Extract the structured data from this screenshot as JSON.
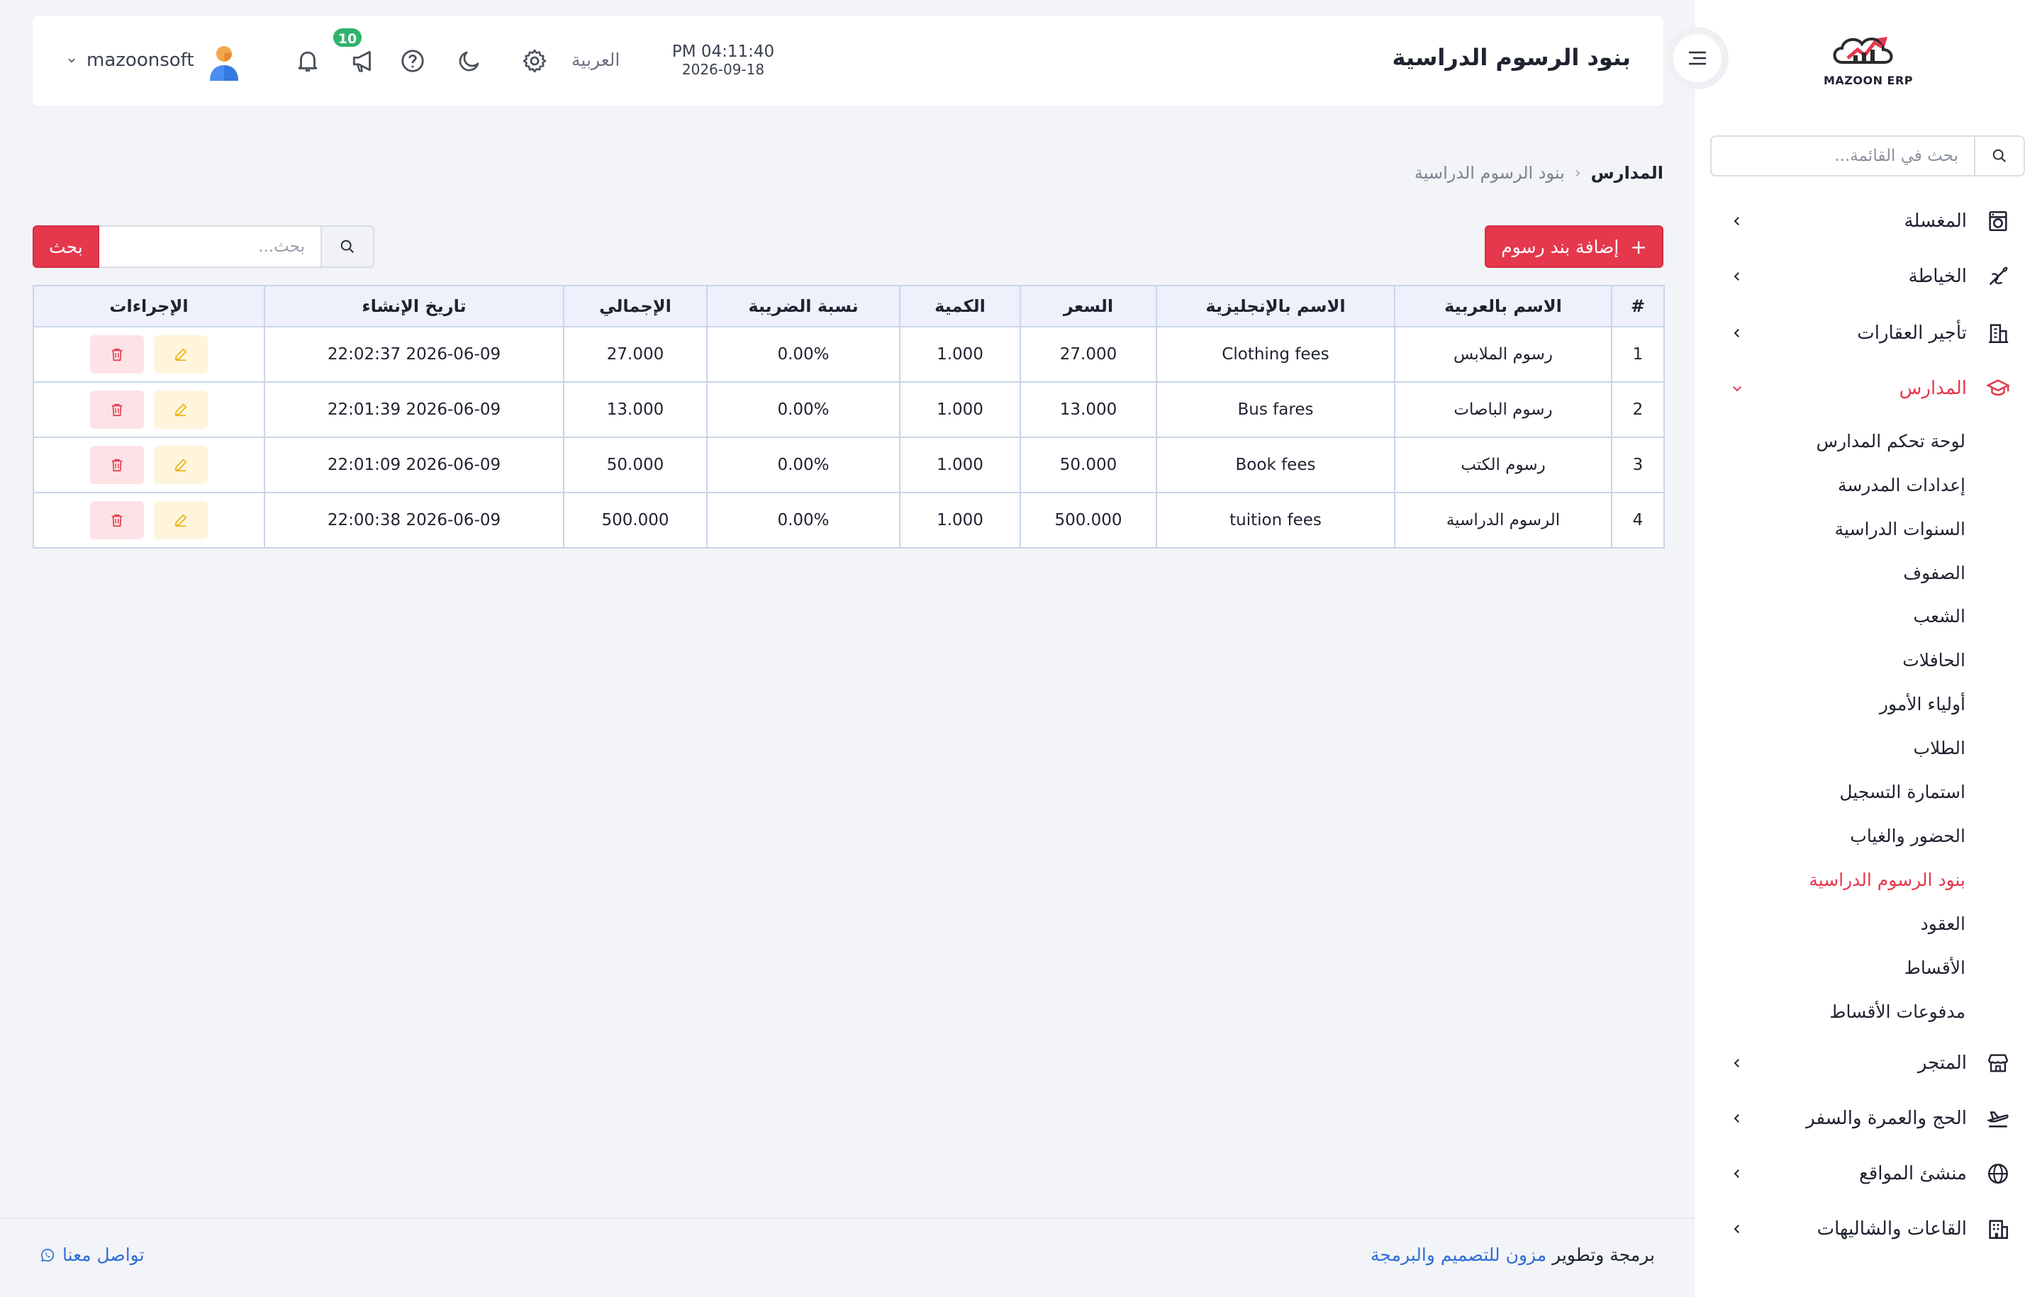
{
  "app": {
    "logo_text": "MAZOON ERP",
    "page_title": "بنود الرسوم الدراسية",
    "accent_color": "#e5384d"
  },
  "header": {
    "time": "PM 04:11:40",
    "date": "2026-09-18",
    "language": "العربية",
    "notifications_badge": "10",
    "username": "mazoonsoft",
    "icons": [
      "menu-toggle-icon",
      "gear-icon",
      "moon-icon",
      "help-icon",
      "megaphone-icon",
      "bell-icon",
      "avatar",
      "chevron-down-icon"
    ]
  },
  "sidebar": {
    "search_placeholder": "بحث في القائمة...",
    "items": [
      {
        "label": "المغسلة",
        "icon": "laundry-icon"
      },
      {
        "label": "الخياطة",
        "icon": "sewing-icon"
      },
      {
        "label": "تأجير العقارات",
        "icon": "building-icon"
      },
      {
        "label": "المدارس",
        "icon": "graduation-cap-icon",
        "expanded": true
      },
      {
        "label": "المتجر",
        "icon": "store-icon"
      },
      {
        "label": "الحج والعمرة والسفر",
        "icon": "plane-icon"
      },
      {
        "label": "منشئ المواقع",
        "icon": "globe-icon"
      },
      {
        "label": "القاعات والشاليهات",
        "icon": "hall-icon"
      }
    ],
    "schools_sub": [
      "لوحة تحكم المدارس",
      "إعدادات المدرسة",
      "السنوات الدراسية",
      "الصفوف",
      "الشعب",
      "الحافلات",
      "أولياء الأمور",
      "الطلاب",
      "استمارة التسجيل",
      "الحضور والغياب",
      "بنود الرسوم الدراسية",
      "العقود",
      "الأقساط",
      "مدفوعات الأقساط"
    ]
  },
  "breadcrumb": {
    "root": "المدارس",
    "current": "بنود الرسوم الدراسية"
  },
  "toolbar": {
    "add_label": "إضافة بند رسوم",
    "search_placeholder": "بحث...",
    "search_button": "بحث"
  },
  "table": {
    "columns": [
      "#",
      "الاسم بالعربية",
      "الاسم بالإنجليزية",
      "السعر",
      "الكمية",
      "نسبة الضريبة",
      "الإجمالي",
      "تاريخ الإنشاء",
      "الإجراءات"
    ],
    "rows": [
      [
        "1",
        "رسوم الملابس",
        "Clothing fees",
        "27.000",
        "1.000",
        "0.00%",
        "27.000",
        "2026-06-09 22:02:37"
      ],
      [
        "2",
        "رسوم الباصات",
        "Bus fares",
        "13.000",
        "1.000",
        "0.00%",
        "13.000",
        "2026-06-09 22:01:39"
      ],
      [
        "3",
        "رسوم الكتب",
        "Book fees",
        "50.000",
        "1.000",
        "0.00%",
        "50.000",
        "2026-06-09 22:01:09"
      ],
      [
        "4",
        "الرسوم الدراسية",
        "tuition fees",
        "500.000",
        "1.000",
        "0.00%",
        "500.000",
        "2026-06-09 22:00:38"
      ]
    ]
  },
  "footer": {
    "credit_prefix": "برمجة وتطوير",
    "credit_brand": "مزون للتصميم والبرمجة",
    "contact": "تواصل معنا"
  }
}
